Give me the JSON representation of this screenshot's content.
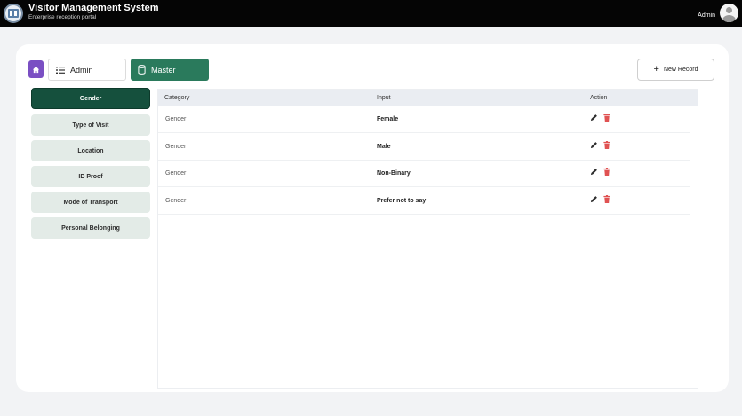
{
  "header": {
    "title": "Visitor Management System",
    "subtitle": "Enterprise reception portal",
    "user": "Admin"
  },
  "breadcrumb": {
    "admin_label": "Admin",
    "master_label": "Master"
  },
  "toolbar": {
    "new_record_label": "New Record"
  },
  "sidebar": {
    "items": [
      {
        "label": "Gender",
        "active": true
      },
      {
        "label": "Type of Visit",
        "active": false
      },
      {
        "label": "Location",
        "active": false
      },
      {
        "label": "ID Proof",
        "active": false
      },
      {
        "label": "Mode of Transport",
        "active": false
      },
      {
        "label": "Personal Belonging",
        "active": false
      }
    ]
  },
  "table": {
    "columns": [
      "Category",
      "Input",
      "Action"
    ],
    "rows": [
      {
        "category": "Gender",
        "input": "Female"
      },
      {
        "category": "Gender",
        "input": "Male"
      },
      {
        "category": "Gender",
        "input": "Non-Binary"
      },
      {
        "category": "Gender",
        "input": "Prefer not to say"
      }
    ]
  },
  "colors": {
    "accent_green": "#15503d",
    "master_green": "#2a7a5c",
    "home_purple": "#7a4fc3",
    "delete_red": "#e05252"
  },
  "icons": [
    "app-logo-icon",
    "home-icon",
    "list-icon",
    "database-icon",
    "plus-icon",
    "edit-icon",
    "delete-icon",
    "avatar-icon"
  ]
}
